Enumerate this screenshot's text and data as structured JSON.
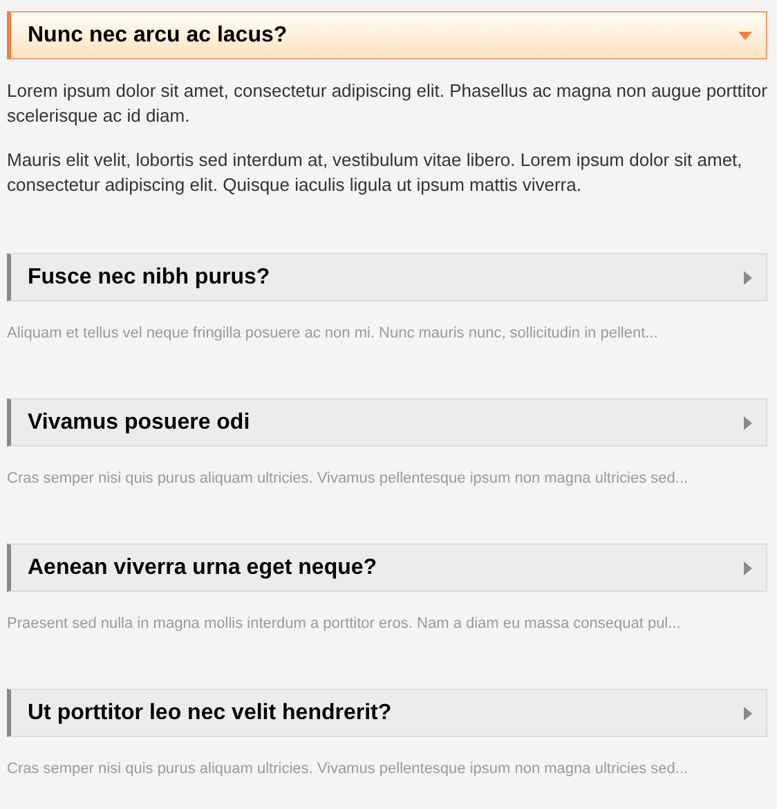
{
  "items": [
    {
      "title": "Nunc nec arcu ac lacus?",
      "expanded": true,
      "paragraphs": [
        "Lorem ipsum dolor sit amet, consectetur adipiscing elit. Phasellus ac magna non augue porttitor scelerisque ac id diam.",
        "Mauris elit velit, lobortis sed interdum at, vestibulum vitae libero. Lorem ipsum dolor sit amet, consectetur adipiscing elit. Quisque iaculis ligula ut ipsum mattis viverra."
      ]
    },
    {
      "title": "Fusce nec nibh purus?",
      "expanded": false,
      "preview": "Aliquam et tellus vel neque fringilla posuere ac non mi. Nunc mauris nunc, sollicitudin in pellent..."
    },
    {
      "title": "Vivamus posuere odi",
      "expanded": false,
      "preview": "Cras semper nisi quis purus aliquam ultricies. Vivamus pellentesque ipsum non magna ultricies sed..."
    },
    {
      "title": "Aenean viverra urna eget neque?",
      "expanded": false,
      "preview": "Praesent sed nulla in magna mollis interdum a porttitor eros. Nam a diam eu massa consequat pul..."
    },
    {
      "title": "Ut porttitor leo nec velit hendrerit?",
      "expanded": false,
      "preview": "Cras semper nisi quis purus aliquam ultricies. Vivamus pellentesque ipsum non magna ultricies sed..."
    }
  ]
}
